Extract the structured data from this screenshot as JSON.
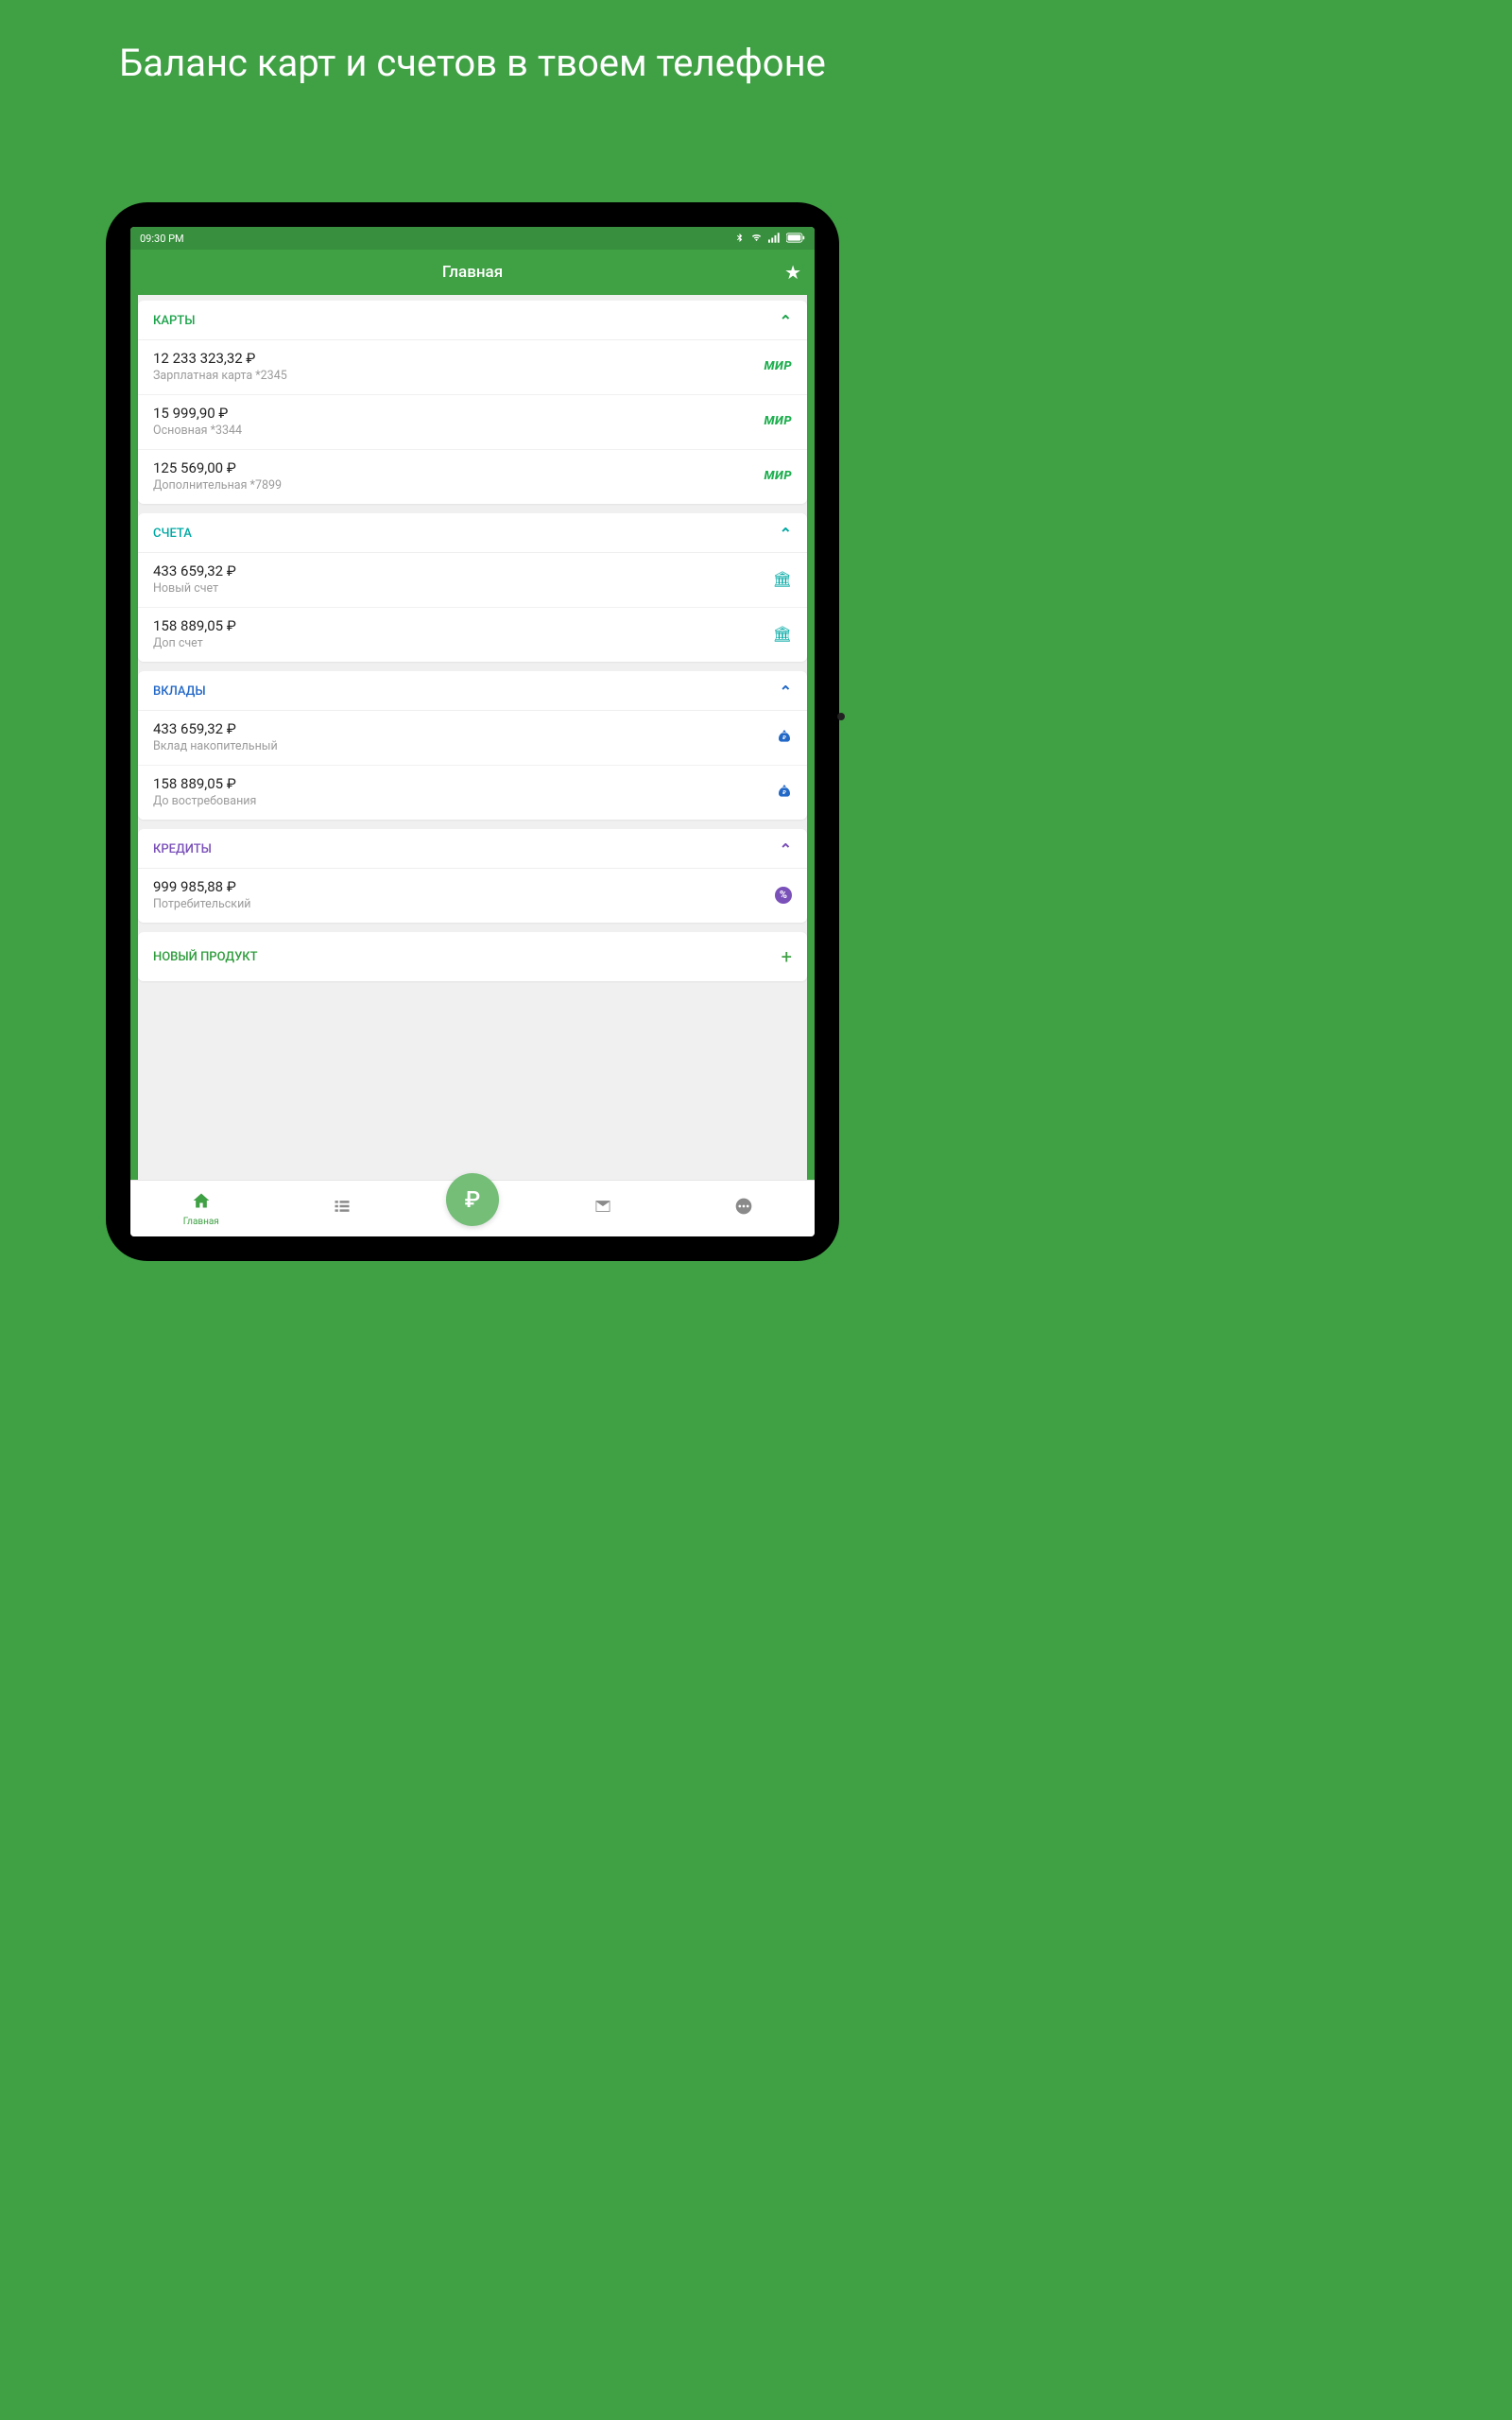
{
  "marketing": {
    "title": "Баланс карт и счетов в твоем телефоне"
  },
  "status_bar": {
    "time": "09:30 PM"
  },
  "header": {
    "title": "Главная"
  },
  "sections": {
    "cards": {
      "title": "КАРТЫ",
      "items": [
        {
          "amount": "12 233 323,32 ₽",
          "subtitle": "Зарплатная карта  *2345",
          "badge": "МИР"
        },
        {
          "amount": "15 999,90 ₽",
          "subtitle": "Основная  *3344",
          "badge": "МИР"
        },
        {
          "amount": "125 569,00 ₽",
          "subtitle": "Дополнительная  *7899",
          "badge": "МИР"
        }
      ]
    },
    "accounts": {
      "title": "СЧЕТА",
      "items": [
        {
          "amount": "433 659,32 ₽",
          "subtitle": "Новый счет"
        },
        {
          "amount": "158 889,05 ₽",
          "subtitle": "Доп счет"
        }
      ]
    },
    "deposits": {
      "title": "ВКЛАДЫ",
      "items": [
        {
          "amount": "433 659,32 ₽",
          "subtitle": "Вклад накопительный"
        },
        {
          "amount": "158 889,05 ₽",
          "subtitle": "До востребования"
        }
      ]
    },
    "credits": {
      "title": "КРЕДИТЫ",
      "items": [
        {
          "amount": "999 985,88 ₽",
          "subtitle": "Потребительский"
        }
      ]
    },
    "new_product": {
      "title": "НОВЫЙ ПРОДУКТ"
    }
  },
  "bottom_nav": {
    "home_label": "Главная",
    "ruble_glyph": "₽"
  }
}
